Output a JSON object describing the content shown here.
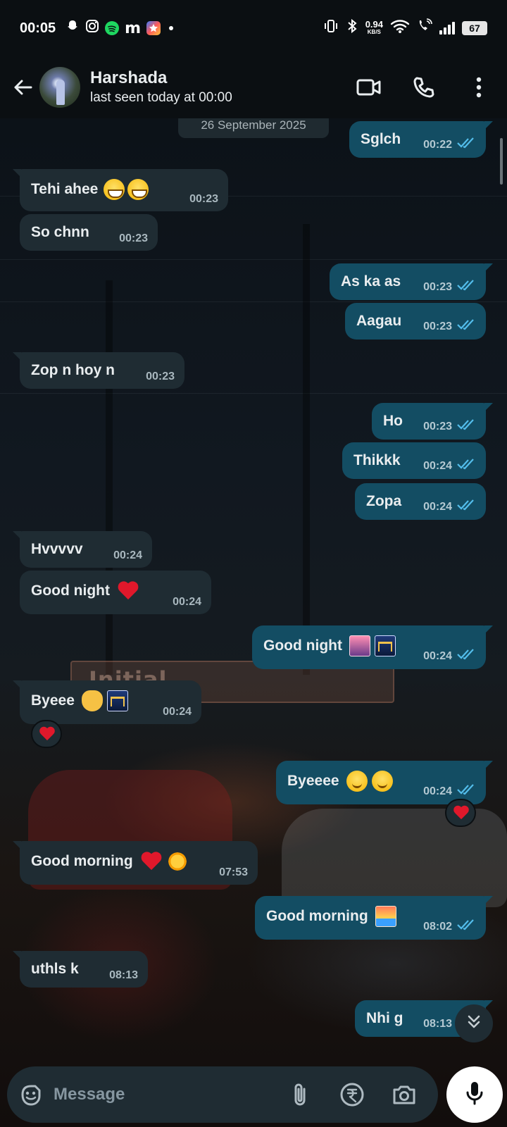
{
  "status_bar": {
    "time": "00:05",
    "net_speed_value": "0.94",
    "net_speed_unit": "KB/S",
    "battery": "67",
    "icons": [
      "snapchat-icon",
      "instagram-icon",
      "spotify-icon",
      "m-app-icon",
      "star-app-icon",
      "dot-icon",
      "vibrate-icon",
      "bluetooth-icon",
      "wifi-icon",
      "wifi-call-icon",
      "signal-icon",
      "battery-icon"
    ]
  },
  "header": {
    "contact_name": "Harshada",
    "last_seen": "last seen today at 00:00",
    "icons": [
      "back-arrow-icon",
      "video-call-icon",
      "voice-call-icon",
      "more-options-icon"
    ]
  },
  "chat": {
    "date_label": "26 September 2025",
    "messages": [
      {
        "dir": "out",
        "text": "Sglch",
        "time": "00:22",
        "ticks": "read"
      },
      {
        "dir": "in",
        "text": "Tehi ahee",
        "emojis": [
          "grin",
          "grin"
        ],
        "time": "00:23"
      },
      {
        "dir": "in",
        "text": "So chnn",
        "time": "00:23"
      },
      {
        "dir": "out",
        "text": "As ka as",
        "time": "00:23",
        "ticks": "read"
      },
      {
        "dir": "out",
        "text": "Aagau",
        "time": "00:23",
        "ticks": "read"
      },
      {
        "dir": "in",
        "text": "Zop n hoy n",
        "time": "00:23"
      },
      {
        "dir": "out",
        "text": "Ho",
        "time": "00:23",
        "ticks": "read"
      },
      {
        "dir": "out",
        "text": "Thikkk",
        "time": "00:24",
        "ticks": "read"
      },
      {
        "dir": "out",
        "text": "Zopa",
        "time": "00:24",
        "ticks": "read"
      },
      {
        "dir": "in",
        "text": "Hvvvvv",
        "time": "00:24"
      },
      {
        "dir": "in",
        "text": "Good night",
        "emojis": [
          "heart"
        ],
        "time": "00:24"
      },
      {
        "dir": "out",
        "text": "Good night",
        "emojis": [
          "city-dusk",
          "bridge-night"
        ],
        "time": "00:24",
        "ticks": "read"
      },
      {
        "dir": "in",
        "text": "Byeee",
        "emojis": [
          "wave",
          "bridge-night"
        ],
        "time": "00:24",
        "reaction": "heart"
      },
      {
        "dir": "out",
        "text": "Byeeee",
        "emojis": [
          "smile",
          "relieved"
        ],
        "time": "00:24",
        "ticks": "read",
        "reaction": "heart"
      },
      {
        "dir": "in",
        "text": "Good morning",
        "emojis": [
          "heart",
          "sun"
        ],
        "time": "07:53"
      },
      {
        "dir": "out",
        "text": "Good morning",
        "emojis": [
          "sunrise"
        ],
        "time": "08:02",
        "ticks": "read"
      },
      {
        "dir": "in",
        "text": "uthls k",
        "time": "08:13"
      },
      {
        "dir": "out",
        "text": "Nhi g",
        "time": "08:13",
        "ticks": "read"
      }
    ]
  },
  "composer": {
    "placeholder": "Message",
    "icons": [
      "emoji-sticker-icon",
      "attach-icon",
      "rupee-payment-icon",
      "camera-icon",
      "microphone-icon"
    ]
  },
  "colors": {
    "incoming_bubble": "#1f2c33",
    "outgoing_bubble": "#134d63",
    "read_ticks": "#53bdeb",
    "background": "#0b0f12"
  }
}
